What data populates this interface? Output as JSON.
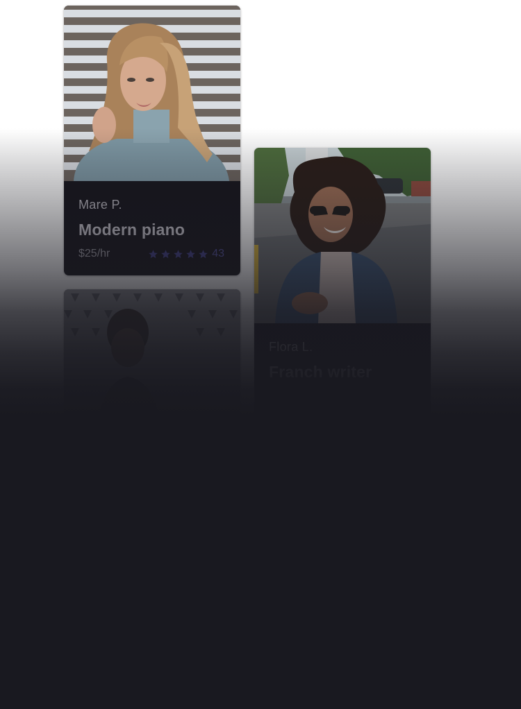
{
  "colors": {
    "page_background": "#191920",
    "card_background": "#16151c",
    "star_color": "#3f3d82",
    "rating_count_color": "#4f4d96"
  },
  "cards": [
    {
      "name": "Mare P.",
      "title": "Modern piano",
      "price": "$25/hr",
      "rating_stars": 5,
      "rating_count": "43",
      "photo": "woman-in-grey-turtleneck-photo"
    },
    {
      "name": "Flora L.",
      "title": "Franch writer",
      "photo": "woman-with-sunglasses-and-denim-jacket-photo"
    },
    {
      "photo": "person-against-geometric-wall-photo"
    }
  ]
}
